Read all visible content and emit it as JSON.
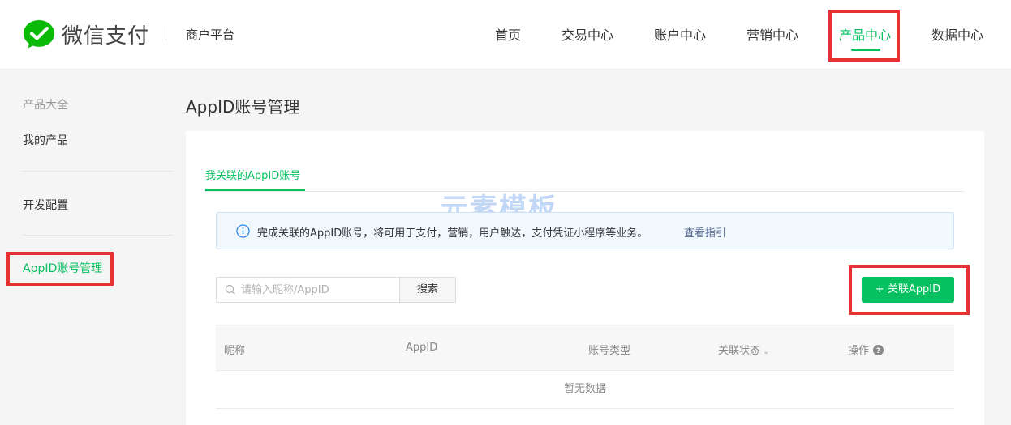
{
  "header": {
    "brand": "微信支付",
    "platform": "商户平台",
    "nav": [
      "首页",
      "交易中心",
      "账户中心",
      "营销中心",
      "产品中心",
      "数据中心"
    ],
    "active_nav": "产品中心"
  },
  "sidebar": {
    "section_title": "产品大全",
    "my_products": "我的产品",
    "dev_config": "开发配置",
    "appid_manage": "AppID账号管理"
  },
  "main": {
    "title": "AppID账号管理",
    "tab": "我关联的AppID账号",
    "watermark": "元素模板",
    "notice": {
      "text": "完成关联的AppID账号，将可用于支付，营销，用户触达，支付凭证小程序等业务。",
      "link": "查看指引"
    },
    "search": {
      "placeholder": "请输入昵称/AppID",
      "button": "搜索"
    },
    "add_button": "+ 关联AppID",
    "table": {
      "columns": [
        "昵称",
        "AppID",
        "账号类型",
        "关联状态",
        "操作"
      ],
      "empty": "暂无数据"
    }
  },
  "colors": {
    "accent": "#07c160",
    "highlight": "#e63232",
    "link": "#576b95"
  },
  "icons": [
    "wechat-pay-logo-icon",
    "info-icon",
    "search-icon",
    "chevron-down-icon",
    "help-icon"
  ]
}
